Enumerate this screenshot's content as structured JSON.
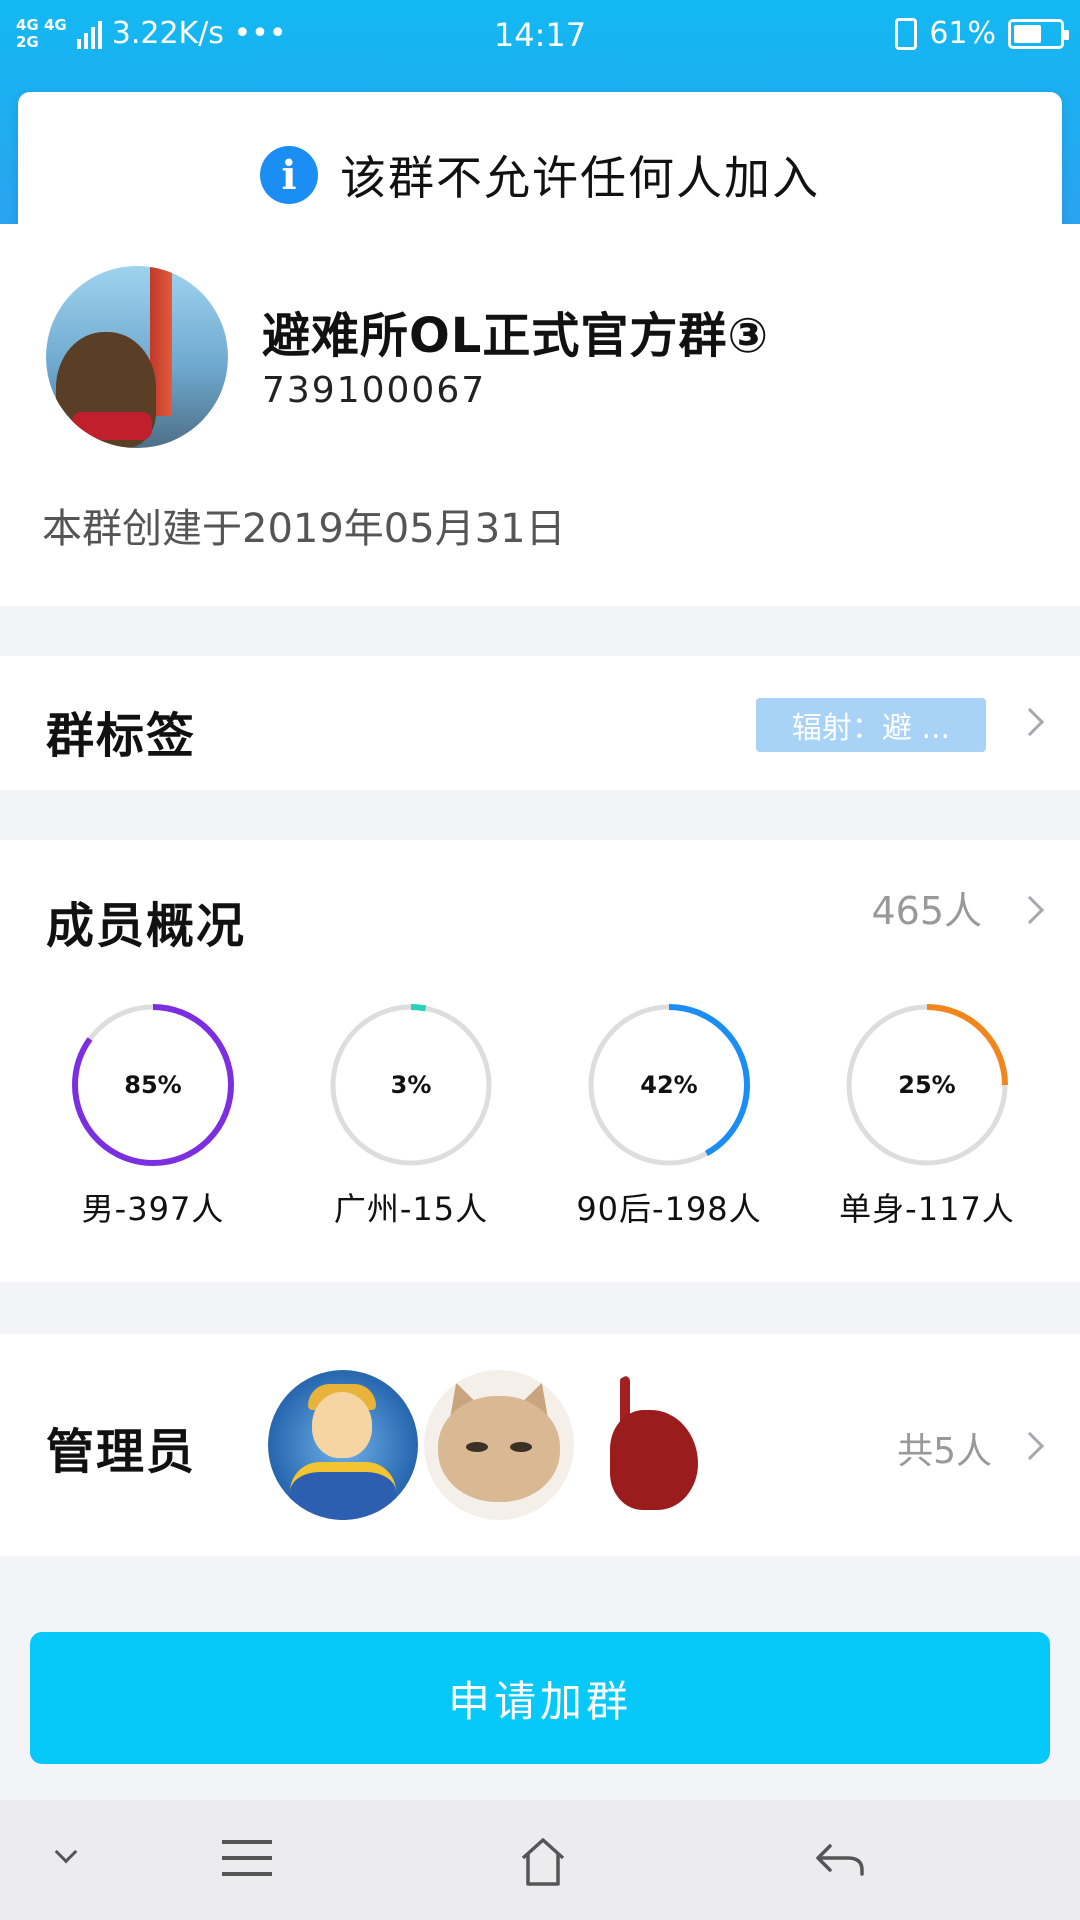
{
  "status_bar": {
    "network": [
      "4G 4G",
      "2G"
    ],
    "speed": "3.22K/s •••",
    "time": "14:17",
    "battery": "61%",
    "battery_level": 0.61
  },
  "notice": {
    "icon": "info-icon",
    "text": "该群不允许任何人加入"
  },
  "group": {
    "name": "避难所OL正式官方群③",
    "id": "739100067",
    "created": "本群创建于2019年05月31日"
  },
  "tags": {
    "title": "群标签",
    "chip": "辐射：避 ..."
  },
  "members": {
    "title": "成员概况",
    "count": "465人",
    "stats": [
      {
        "percent": 85,
        "percent_label": "85%",
        "label": "男-397人",
        "color": "#7b2fe0"
      },
      {
        "percent": 3,
        "percent_label": "3%",
        "label": "广州-15人",
        "color": "#27d3b8"
      },
      {
        "percent": 42,
        "percent_label": "42%",
        "label": "90后-198人",
        "color": "#1a8ef2"
      },
      {
        "percent": 25,
        "percent_label": "25%",
        "label": "单身-117人",
        "color": "#f2861e"
      }
    ]
  },
  "admins": {
    "title": "管理员",
    "count": "共5人"
  },
  "join_button": "申请加群",
  "colors": {
    "header": "#12b9f2",
    "accent": "#06c8f9",
    "tag_chip": "#a9d2f7",
    "info_icon": "#1a8ef2"
  }
}
